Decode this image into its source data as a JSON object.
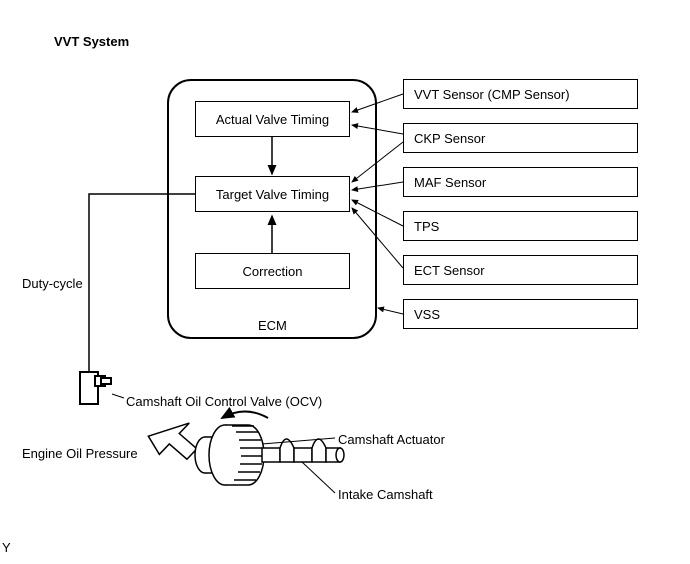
{
  "title": "VVT System",
  "ecm": {
    "label": "ECM",
    "blocks": {
      "actual": "Actual Valve Timing",
      "target": "Target Valve Timing",
      "correction": "Correction"
    }
  },
  "sensors": [
    "VVT Sensor (CMP Sensor)",
    "CKP Sensor",
    "MAF Sensor",
    "TPS",
    "ECT Sensor",
    "VSS"
  ],
  "labels": {
    "dutycycle": "Duty-cycle",
    "ocv": "Camshaft Oil Control Valve (OCV)",
    "oilpressure": "Engine Oil Pressure",
    "actuator": "Camshaft Actuator",
    "intake": "Intake Camshaft"
  },
  "footnote": "Y"
}
